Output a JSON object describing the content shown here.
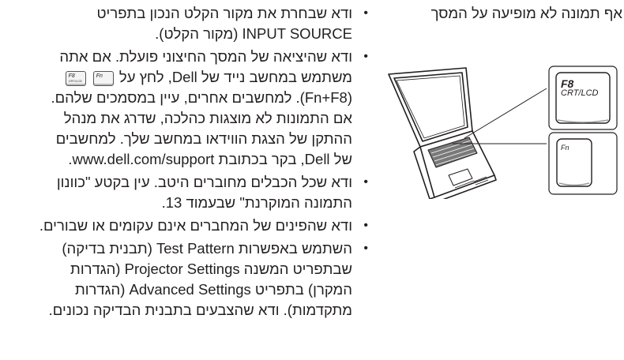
{
  "problem": {
    "text": "אף תמונה לא מופיעה על המסך"
  },
  "figure": {
    "key_f8_top": "F8",
    "key_f8_bottom": "CRT/LCD",
    "key_fn": "Fn"
  },
  "solutions": {
    "item1": {
      "line1": "ודא שבחרת את מקור הקלט הנכון בתפריט",
      "line2": "INPUT SOURCE (מקור הקלט)."
    },
    "item2": {
      "line1": "ודא שהיציאה של המסך החיצוני פועלת. אם אתה",
      "line2": "משתמש במחשב נייד של Dell, לחץ על",
      "chip_f8_top": "F8",
      "chip_f8_bottom": "CRT/LCD",
      "chip_fn": "Fn",
      "line3": "(Fn+F8). למחשבים אחרים, עיין במסמכים שלהם.",
      "line4": "אם התמונות לא מוצגות כהלכה, שדרג את מנהל",
      "line5": "ההתקן של הצגת הווידאו במחשב שלך. למחשבים",
      "line6": "של Dell, בקר בכתובת www.dell.com/support."
    },
    "item3": {
      "line1": "ודא שכל הכבלים מחוברים היטב. עין בקטע \"כוונון",
      "line2": "התמונה המוקרנת\" שבעמוד 13."
    },
    "item4": {
      "line1": "ודא שהפינים של המחברים אינם עקומים או שבורים."
    },
    "item5": {
      "line1": "השתמש באפשרות Test Pattern (תבנית בדיקה)",
      "line2": "שבתפריט המשנה Projector Settings (הגדרות",
      "line3": "המקרן) בתפריט Advanced Settings (הגדרות",
      "line4": "מתקדמות). ודא שהצבעים בתבנית הבדיקה נכונים."
    },
    "bullet": "•"
  }
}
